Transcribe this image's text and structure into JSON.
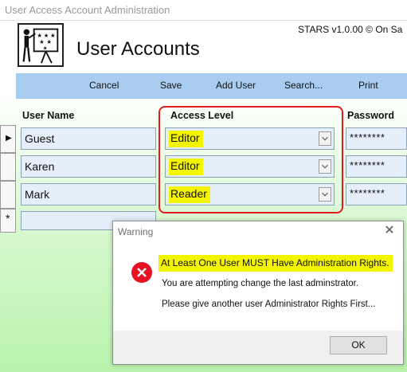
{
  "window": {
    "title": "User Access Account Administration"
  },
  "header": {
    "title": "User Accounts",
    "version_text": "STARS v1.0.00 © On Sa"
  },
  "toolbar": {
    "cancel": "Cancel",
    "save": "Save",
    "add_user": "Add User",
    "search": "Search...",
    "print": "Print"
  },
  "columns": {
    "user_name": "User Name",
    "access_level": "Access Level",
    "password": "Password"
  },
  "rows": [
    {
      "user_name": "Guest",
      "access_level": "Editor",
      "password": "********"
    },
    {
      "user_name": "Karen",
      "access_level": "Editor",
      "password": "********"
    },
    {
      "user_name": "Mark",
      "access_level": "Reader",
      "password": "********"
    }
  ],
  "new_row_marker": "*",
  "current_row_marker": "▶",
  "dialog": {
    "title": "Warning",
    "close": "✕",
    "message_main": "At Least One User MUST Have Administration Rights.",
    "message_line2": "You are attempting change the last adminstrator.",
    "message_line3": "Please give another user Administrator Rights First...",
    "ok": "OK"
  },
  "colors": {
    "toolbar_bg": "#a9cdf0",
    "highlight": "#f3f500",
    "annotation_red": "#e21b1b",
    "error_icon": "#e81123"
  }
}
